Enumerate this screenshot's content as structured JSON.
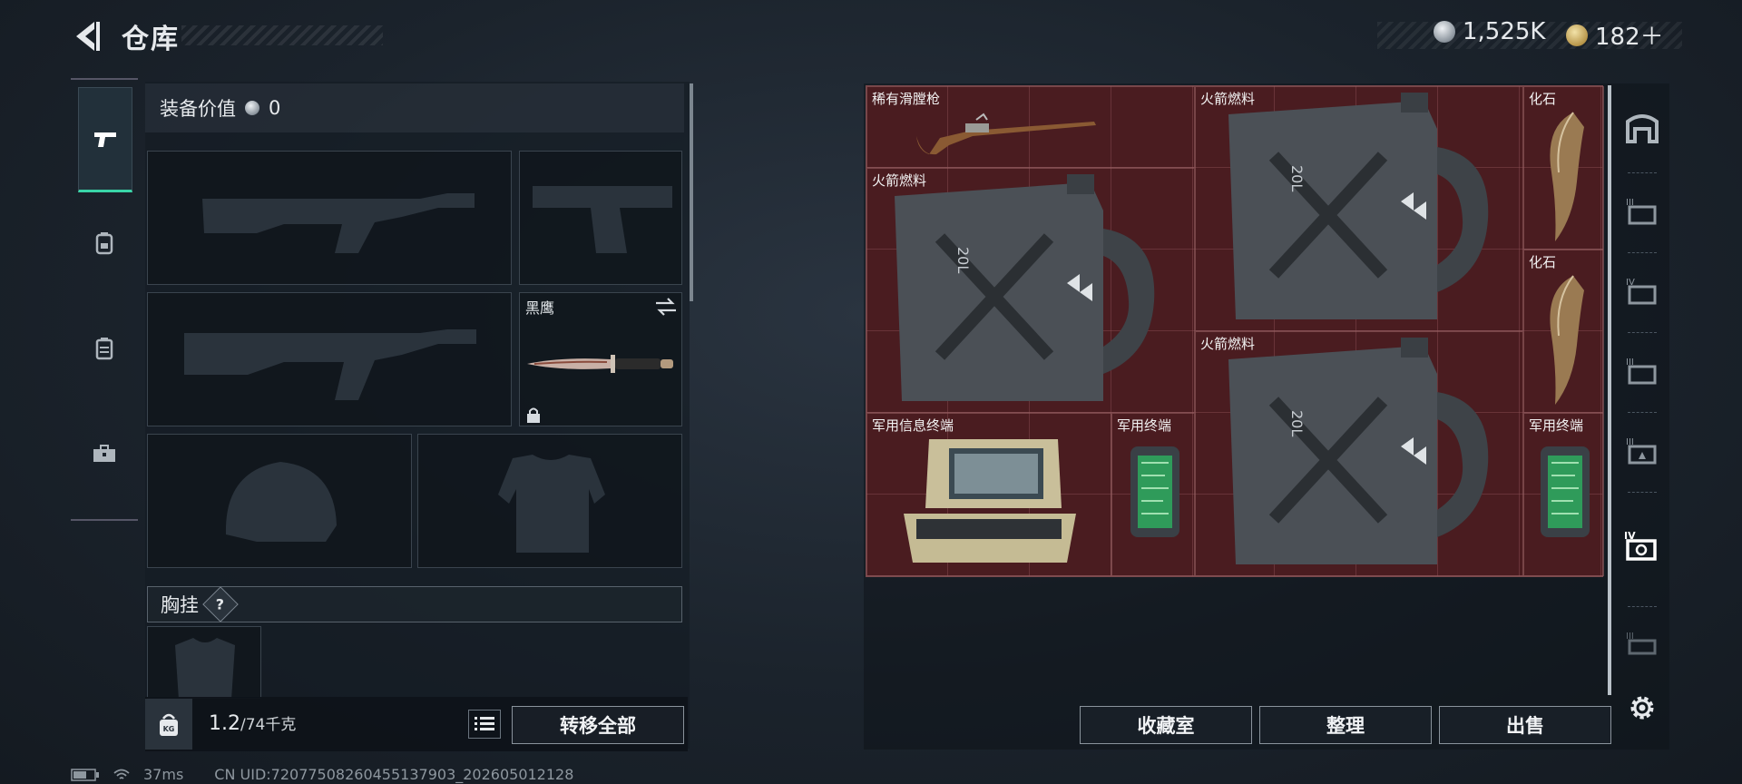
{
  "header": {
    "title": "仓库",
    "currency_silver": "1,525K",
    "currency_gold": "182＋"
  },
  "left_nav": {
    "items": [
      {
        "icon": "pistol-icon",
        "active": true
      },
      {
        "icon": "backpack-icon",
        "active": false
      },
      {
        "icon": "vest-icon",
        "active": false
      },
      {
        "icon": "toolbox-icon",
        "active": false
      }
    ]
  },
  "equipment": {
    "value_label": "装备价值",
    "value": "0",
    "knife_name": "黑鹰",
    "chest_rig_label": "胸挂",
    "chest_rig_hint": "?",
    "weight_current": "1.2",
    "weight_max": "/74千克",
    "transfer_all_label": "转移全部"
  },
  "stash": {
    "items": [
      {
        "name": "稀有滑膛枪",
        "icon": "musket-icon"
      },
      {
        "name": "火箭燃料",
        "icon": "fuel-can-icon"
      },
      {
        "name": "化石",
        "icon": "fossil-claw-icon"
      },
      {
        "name": "火箭燃料",
        "icon": "fuel-can-icon"
      },
      {
        "name": "化石",
        "icon": "fossil-claw-icon"
      },
      {
        "name": "火箭燃料",
        "icon": "fuel-can-icon"
      },
      {
        "name": "军用信息终端",
        "icon": "military-terminal-case-icon"
      },
      {
        "name": "军用终端",
        "icon": "military-terminal-icon"
      },
      {
        "name": "军用终端",
        "icon": "military-terminal-icon"
      }
    ],
    "can_text": "20L",
    "buttons": {
      "collection": "收藏室",
      "organize": "整理",
      "sell": "出售"
    }
  },
  "status_bar": {
    "ping": "37ms",
    "uid": "CN UID:72077508260455137903_202605012128"
  },
  "colors": {
    "accent": "#39d5a8",
    "stash_bg": "#4a1c20",
    "panel_bg": "#141b23"
  }
}
